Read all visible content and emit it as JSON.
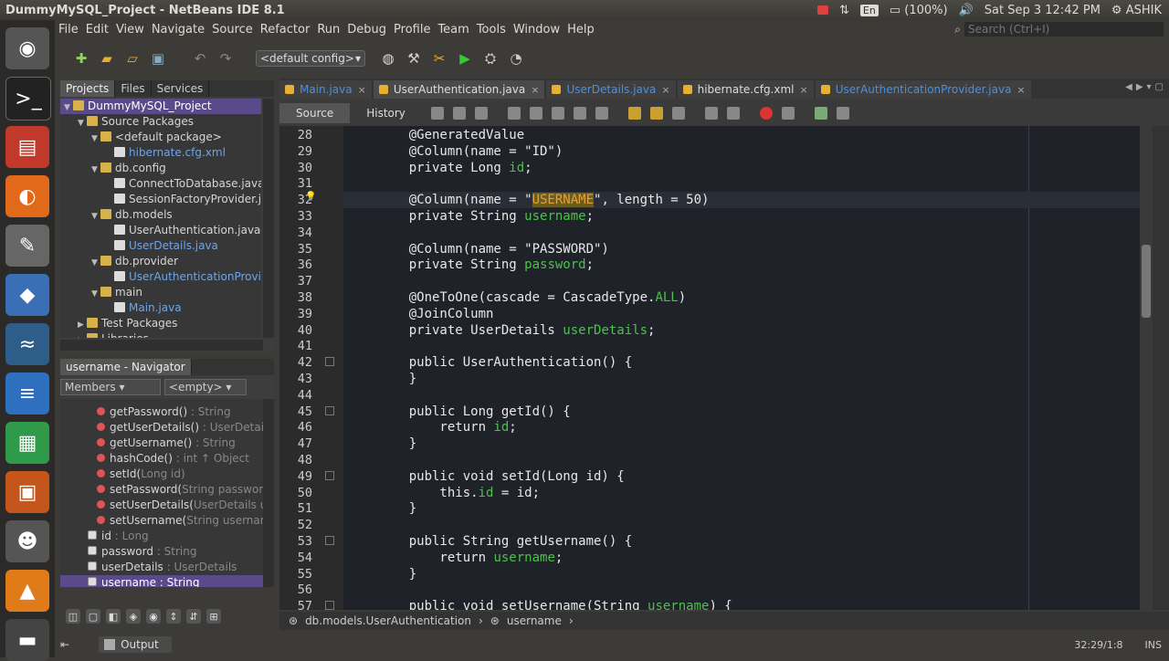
{
  "window": {
    "title": "DummyMySQL_Project - NetBeans IDE 8.1"
  },
  "system": {
    "keyboard": "En",
    "battery": "(100%)",
    "datetime": "Sat Sep  3 12:42 PM",
    "user": "ASHIK"
  },
  "menu": [
    "File",
    "Edit",
    "View",
    "Navigate",
    "Source",
    "Refactor",
    "Run",
    "Debug",
    "Profile",
    "Team",
    "Tools",
    "Window",
    "Help"
  ],
  "search": {
    "placeholder": "Search (Ctrl+I)"
  },
  "toolbar": {
    "config": "<default config>"
  },
  "left_tabs": [
    "Projects",
    "Files",
    "Services"
  ],
  "project_tree": [
    {
      "label": "DummyMySQL_Project",
      "depth": 0,
      "arrow": "▼",
      "kind": "project",
      "sel": true
    },
    {
      "label": "Source Packages",
      "depth": 1,
      "arrow": "▼",
      "kind": "pkg"
    },
    {
      "label": "<default package>",
      "depth": 2,
      "arrow": "▼",
      "kind": "pkg"
    },
    {
      "label": "hibernate.cfg.xml",
      "depth": 3,
      "arrow": "",
      "kind": "file",
      "link": true
    },
    {
      "label": "db.config",
      "depth": 2,
      "arrow": "▼",
      "kind": "pkg"
    },
    {
      "label": "ConnectToDatabase.java",
      "depth": 3,
      "arrow": "",
      "kind": "file"
    },
    {
      "label": "SessionFactoryProvider.java",
      "depth": 3,
      "arrow": "",
      "kind": "file"
    },
    {
      "label": "db.models",
      "depth": 2,
      "arrow": "▼",
      "kind": "pkg"
    },
    {
      "label": "UserAuthentication.java",
      "depth": 3,
      "arrow": "",
      "kind": "file"
    },
    {
      "label": "UserDetails.java",
      "depth": 3,
      "arrow": "",
      "kind": "file",
      "link": true
    },
    {
      "label": "db.provider",
      "depth": 2,
      "arrow": "▼",
      "kind": "pkg"
    },
    {
      "label": "UserAuthenticationProvider.java",
      "depth": 3,
      "arrow": "",
      "kind": "file",
      "link": true
    },
    {
      "label": "main",
      "depth": 2,
      "arrow": "▼",
      "kind": "pkg"
    },
    {
      "label": "Main.java",
      "depth": 3,
      "arrow": "",
      "kind": "file",
      "link": true
    },
    {
      "label": "Test Packages",
      "depth": 1,
      "arrow": "▶",
      "kind": "pkg"
    },
    {
      "label": "Libraries",
      "depth": 1,
      "arrow": "▶",
      "kind": "pkg"
    }
  ],
  "navigator": {
    "title": "username - Navigator",
    "filter": "Members",
    "filter2": "<empty>",
    "items": [
      {
        "name": "getPassword()",
        "type": " : String",
        "kind": "method"
      },
      {
        "name": "getUserDetails()",
        "type": " : UserDetails",
        "kind": "method"
      },
      {
        "name": "getUsername()",
        "type": " : String",
        "kind": "method"
      },
      {
        "name": "hashCode()",
        "type": " : int ↑ Object",
        "kind": "method"
      },
      {
        "name": "setId(",
        "type": "Long id)",
        "kind": "method"
      },
      {
        "name": "setPassword(",
        "type": "String password)",
        "kind": "method"
      },
      {
        "name": "setUserDetails(",
        "type": "UserDetails userDetails)",
        "kind": "method"
      },
      {
        "name": "setUsername(",
        "type": "String username)",
        "kind": "method"
      },
      {
        "name": "id",
        "type": " : Long",
        "kind": "field"
      },
      {
        "name": "password",
        "type": " : String",
        "kind": "field"
      },
      {
        "name": "userDetails",
        "type": " : UserDetails",
        "kind": "field"
      },
      {
        "name": "username : String",
        "type": "",
        "kind": "field",
        "sel": true
      }
    ]
  },
  "editor_tabs": [
    {
      "label": "Main.java",
      "blue": true
    },
    {
      "label": "UserAuthentication.java",
      "active": true
    },
    {
      "label": "UserDetails.java",
      "blue": true
    },
    {
      "label": "hibernate.cfg.xml"
    },
    {
      "label": "UserAuthenticationProvider.java",
      "blue": true
    }
  ],
  "editor_modes": [
    "Source",
    "History"
  ],
  "code": [
    {
      "n": "28",
      "t": "    @GeneratedValue"
    },
    {
      "n": "29",
      "t": "    @Column(name = \"ID\")"
    },
    {
      "n": "30",
      "t": "    private Long ",
      "f": "id",
      ";": ";"
    },
    {
      "n": "31",
      "t": ""
    },
    {
      "n": "32",
      "t": "    @Column(name = \"",
      "sel": "USERNAME",
      "after": "\", length = 50)",
      "current": true
    },
    {
      "n": "33",
      "t": "    private String ",
      "f": "username",
      ";": ";"
    },
    {
      "n": "34",
      "t": ""
    },
    {
      "n": "35",
      "t": "    @Column(name = \"PASSWORD\")"
    },
    {
      "n": "36",
      "t": "    private String ",
      "f": "password",
      ";": ";"
    },
    {
      "n": "37",
      "t": ""
    },
    {
      "n": "38",
      "t": "    @OneToOne(cascade = CascadeType.",
      "f": "ALL",
      ";": ")"
    },
    {
      "n": "39",
      "t": "    @JoinColumn"
    },
    {
      "n": "40",
      "t": "    private UserDetails ",
      "f": "userDetails",
      ";": ";"
    },
    {
      "n": "41",
      "t": ""
    },
    {
      "n": "42",
      "t": "    public UserAuthentication() {"
    },
    {
      "n": "43",
      "t": "    }"
    },
    {
      "n": "44",
      "t": ""
    },
    {
      "n": "45",
      "t": "    public Long getId() {"
    },
    {
      "n": "46",
      "t": "        return ",
      "f": "id",
      ";": ";"
    },
    {
      "n": "47",
      "t": "    }"
    },
    {
      "n": "48",
      "t": ""
    },
    {
      "n": "49",
      "t": "    public void setId(Long id) {"
    },
    {
      "n": "50",
      "t": "        this.",
      "f": "id",
      ";": " = id;"
    },
    {
      "n": "51",
      "t": "    }"
    },
    {
      "n": "52",
      "t": ""
    },
    {
      "n": "53",
      "t": "    public String getUsername() {"
    },
    {
      "n": "54",
      "t": "        return ",
      "f": "username",
      ";": ";"
    },
    {
      "n": "55",
      "t": "    }"
    },
    {
      "n": "56",
      "t": ""
    },
    {
      "n": "57",
      "t": "    public void setUsername(String ",
      "f": "username",
      ";": ") {"
    }
  ],
  "breadcrumb": [
    "db.models.UserAuthentication",
    "username"
  ],
  "status": {
    "output": "Output",
    "position": "32:29/1:8",
    "mode": "INS"
  }
}
